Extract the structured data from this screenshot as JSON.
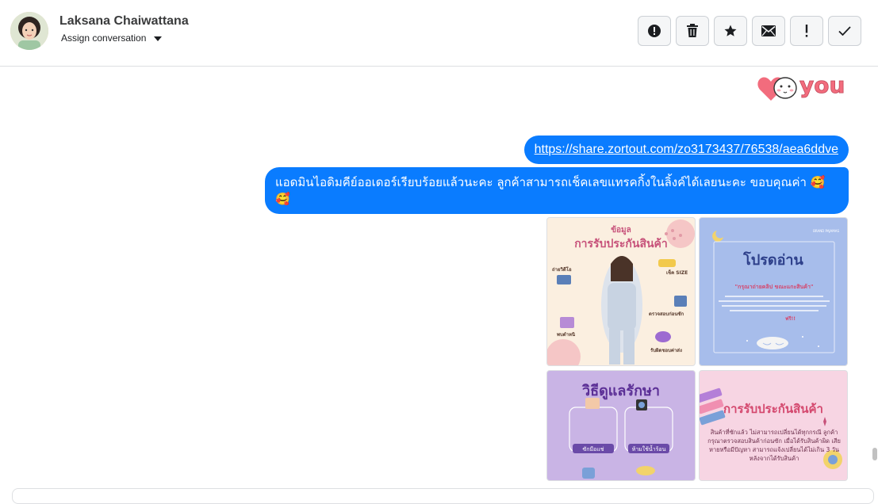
{
  "header": {
    "contact_name": "Laksana Chaiwattana",
    "assign_label": "Assign conversation",
    "actions": [
      {
        "name": "spam-button",
        "icon": "alert-circle-icon"
      },
      {
        "name": "delete-button",
        "icon": "trash-icon"
      },
      {
        "name": "star-button",
        "icon": "star-icon"
      },
      {
        "name": "mark-unread-button",
        "icon": "envelope-icon"
      },
      {
        "name": "follow-up-button",
        "icon": "exclamation-icon"
      },
      {
        "name": "mark-done-button",
        "icon": "check-icon"
      }
    ]
  },
  "messages": {
    "sticker_text": "you",
    "link": "https://share.zortout.com/zo3173437/76538/aea6ddve",
    "text": "แอดมินไอดิมคีย์ออเดอร์เรียบร้อยแล้วนะคะ ลูกค้าสามารถเช็คเลขแทรคกิ้งในลิ้งค์ได้เลยนะคะ ขอบคุณค่า 🥰 🥰"
  },
  "images": {
    "tile_a": {
      "title_small": "ข้อมูล",
      "title": "การรับประกันสินค้า",
      "labels": [
        "ถ่ายวิดีโอ",
        "เช็ค SIZE",
        "ตรวจสอบก่อนซัก",
        "พบตำหนิ",
        "รับผิดชอบค่าส่ง"
      ]
    },
    "tile_b": {
      "brand": "BRAND PAJAMAS",
      "title": "โปรดอ่าน",
      "subtitle": "\"กรุณาถ่ายคลิป ขณะแกะสินค้า\"",
      "highlight": "ฟรี!!"
    },
    "tile_c": {
      "title": "วิธีดูแลรักษา",
      "label_1": "ซักมือแช่",
      "label_2": "ห้ามใช้น้ำร้อน"
    },
    "tile_d": {
      "title": "การรับประกันสินค้า",
      "body": "สินค้าที่ซักแล้ว ไม่สามารถเปลี่ยนได้ทุกกรณี ลูกค้ากรุณาตรวจสอบสินค้าก่อนซัก เมื่อได้รับสินค้าผิด เสียหายหรือมีปัญหา สามารถแจ้งเปลี่ยนได้ไม่เกิน 3 วัน หลังจากได้รับสินค้า"
    }
  },
  "colors": {
    "bubble": "#0a7cff",
    "header_border": "#dddfe2"
  }
}
